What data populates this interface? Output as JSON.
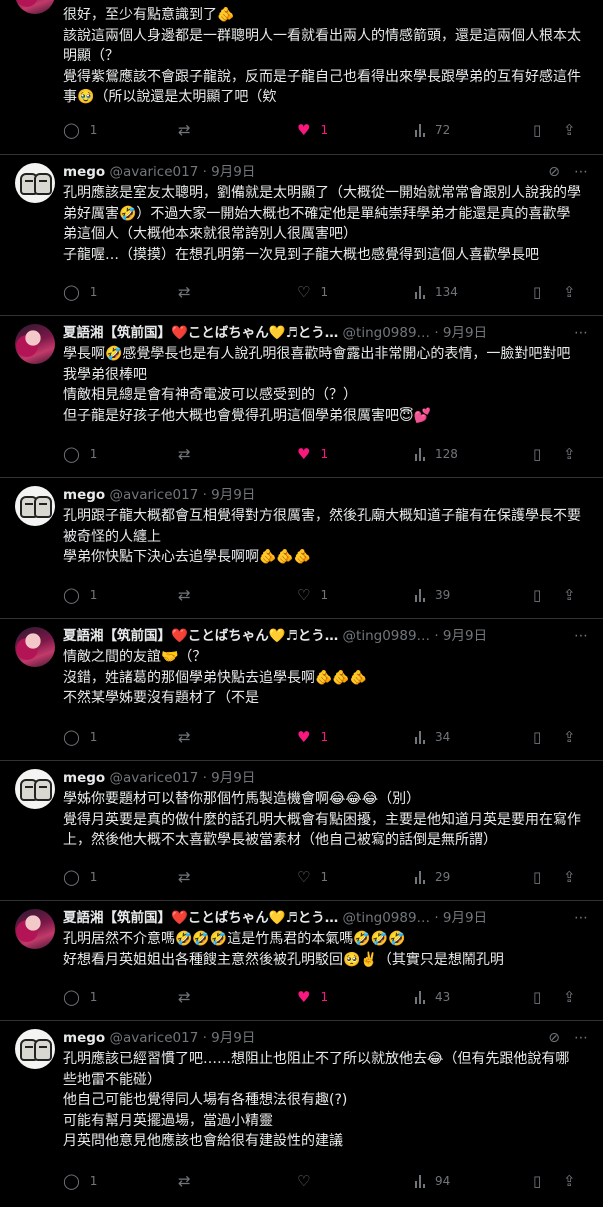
{
  "tweets": [
    {
      "id": "t0",
      "avatar": "anime",
      "show_header": false,
      "body": "很好，至少有點意識到了🫵\n該說這兩個人身邊都是一群聰明人一看就看出兩人的情感箭頭，還是這兩個人根本太明顯（？\n覺得紫鴛應該不會跟子龍說，反而是子龍自己也看得出來學長跟學弟的互有好感這件事🥹（所以說還是太明顯了吧（欸",
      "replies": "1",
      "retweets": "",
      "likes": "1",
      "liked": true,
      "views": "72"
    },
    {
      "id": "t1",
      "avatar": "mego",
      "show_header": true,
      "name": "mego",
      "handle": "@avarice017 · 9月9日",
      "body": "孔明應該是室友太聰明，劉備就是太明顯了（大概從一開始就常常會跟別人說我的學弟好厲害🤣）不過大家一開始大概也不確定他是單純崇拜學弟才能還是真的喜歡學弟這個人（大概他本來就很常誇別人很厲害吧）\n子龍喔…（摸摸）在想孔明第一次見到子龍大概也感覺得到這個人喜歡學長吧",
      "replies": "1",
      "retweets": "",
      "likes": "1",
      "liked": false,
      "views": "134"
    },
    {
      "id": "t2",
      "avatar": "anime",
      "show_header": true,
      "name": "夏語湘【筑前国】❤️ことばちゃん💛♬とう…",
      "handle": "@ting0989… · 9月9日",
      "body": "學長啊🤣感覺學長也是有人說孔明很喜歡時會露出非常開心的表情，一臉對吧對吧我學弟很棒吧\n情敵相見總是會有神奇電波可以感受到的（？）\n但子龍是好孩子他大概也會覺得孔明這個學弟很厲害吧😇💕",
      "replies": "1",
      "retweets": "",
      "likes": "1",
      "liked": true,
      "views": "128"
    },
    {
      "id": "t3",
      "avatar": "mego",
      "show_header": true,
      "name": "mego",
      "handle": "@avarice017 · 9月9日",
      "body": "孔明跟子龍大概都會互相覺得對方很厲害，然後孔廟大概知道子龍有在保護學長不要被奇怪的人纏上\n學弟你快點下決心去追學長啊啊🫵🫵🫵",
      "replies": "1",
      "retweets": "",
      "likes": "1",
      "liked": false,
      "views": "39"
    },
    {
      "id": "t4",
      "avatar": "anime",
      "show_header": true,
      "name": "夏語湘【筑前国】❤️ことばちゃん💛♬とう…",
      "handle": "@ting0989… · 9月9日",
      "body": "情敵之間的友誼🤝（？\n沒錯，姓諸葛的那個學弟快點去追學長啊🫵🫵🫵\n不然某學姊要沒有題材了（不是",
      "replies": "1",
      "retweets": "",
      "likes": "1",
      "liked": true,
      "views": "34"
    },
    {
      "id": "t5",
      "avatar": "mego",
      "show_header": true,
      "name": "mego",
      "handle": "@avarice017 · 9月9日",
      "body": "學姊你要題材可以替你那個竹馬製造機會啊😂😂😂（別）\n覺得月英要是真的做什麼的話孔明大概會有點困擾，主要是他知道月英是要用在寫作上，然後他大概不太喜歡學長被當素材（他自己被寫的話倒是無所謂）",
      "replies": "1",
      "retweets": "",
      "likes": "1",
      "liked": false,
      "views": "29"
    },
    {
      "id": "t6",
      "avatar": "anime",
      "show_header": true,
      "name": "夏語湘【筑前国】❤️ことばちゃん💛♬とう…",
      "handle": "@ting0989… · 9月9日",
      "body": "孔明居然不介意嗎🤣🤣🤣這是竹馬君的本氣嗎🤣🤣🤣\n好想看月英姐姐出各種餿主意然後被孔明駁回🥺✌️（其實只是想鬧孔明",
      "replies": "1",
      "retweets": "",
      "likes": "1",
      "liked": true,
      "views": "43"
    },
    {
      "id": "t7",
      "avatar": "mego",
      "show_header": true,
      "name": "mego",
      "handle": "@avarice017 · 9月9日",
      "body": "孔明應該已經習慣了吧……想阻止也阻止不了所以就放他去😂（但有先跟他說有哪些地雷不能碰）\n他自己可能也覺得同人場有各種想法很有趣(?)\n可能有幫月英擺過場，當過小精靈\n月英問他意見他應該也會給很有建設性的建議",
      "replies": "1",
      "retweets": "",
      "likes": "",
      "liked": false,
      "views": "94"
    }
  ],
  "icons": {
    "reply": "reply-icon",
    "retweet": "retweet-icon",
    "like": "heart-icon",
    "views": "views-icon",
    "bookmark": "bookmark-icon",
    "share": "share-icon",
    "grok": "grok-icon",
    "more": "more-icon"
  },
  "colors": {
    "background": "#000000",
    "text": "#e7e9ea",
    "muted": "#71767b",
    "like_active": "#f91880",
    "divider": "#2f3336"
  }
}
